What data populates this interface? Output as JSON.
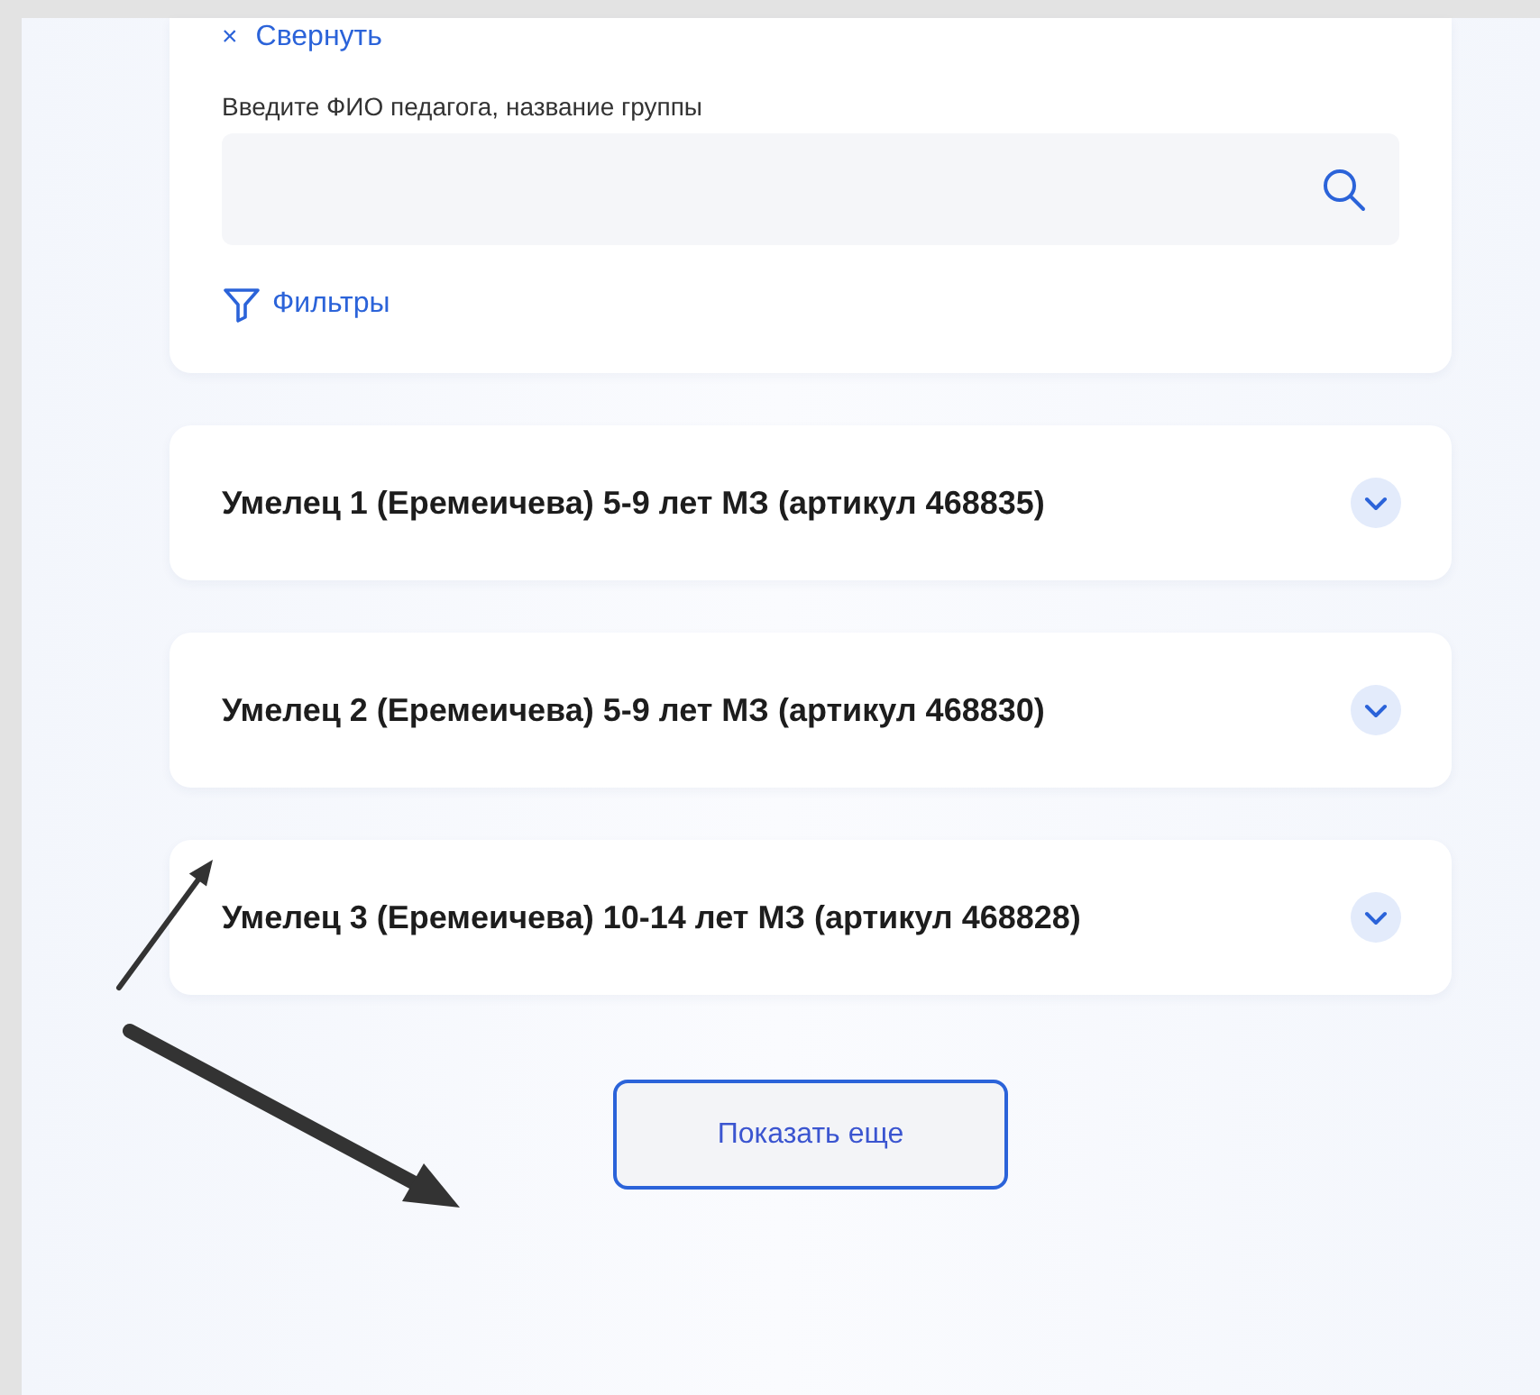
{
  "collapse_link": {
    "icon": "×",
    "label": "Свернуть"
  },
  "search": {
    "label": "Введите ФИО педагога, название группы"
  },
  "filters_link": {
    "label": "Фильтры"
  },
  "groups": [
    {
      "title": "Умелец 1 (Еремеичева) 5-9 лет МЗ (артикул 468835)",
      "expanded": false
    },
    {
      "title": "Умелец 2 (Еремеичева) 5-9 лет МЗ (артикул 468830)",
      "expanded": false
    },
    {
      "title": "Умелец 3 (Еремеичева) 10-14 лет МЗ (артикул 468828)",
      "expanded": false
    }
  ],
  "show_more_button": {
    "label": "Показать еще"
  }
}
